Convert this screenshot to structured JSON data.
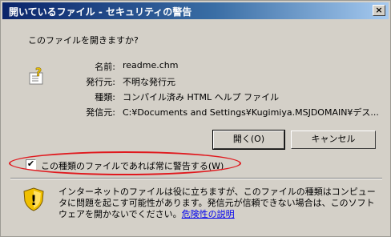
{
  "window": {
    "title": "開いているファイル - セキュリティの警告",
    "close_label": "×"
  },
  "dialog": {
    "prompt": "このファイルを開きますか?",
    "file_icon": "help-file-icon",
    "fields": [
      {
        "label": "名前:",
        "value": "readme.chm"
      },
      {
        "label": "発行元:",
        "value": "不明な発行元"
      },
      {
        "label": "種類:",
        "value": "コンパイル済み HTML ヘルプ ファイル"
      },
      {
        "label": "発信元:",
        "value": "C:¥Documents and Settings¥Kugimiya.MSJDOMAIN¥デス..."
      }
    ],
    "buttons": {
      "open": "開く(O)",
      "cancel": "キャンセル"
    },
    "checkbox": {
      "checked": true,
      "mark": "✔",
      "label": "この種類のファイルであれば常に警告する(W)"
    },
    "warning": {
      "icon": "security-shield-icon",
      "text": "インターネットのファイルは役に立ちますが、このファイルの種類はコンピュータに問題を起こす可能性があります。発信元が信頼できない場合は、このソフトウェアを開かないでください。",
      "link": "危険性の説明"
    }
  },
  "colors": {
    "titlebar_start": "#0a246a",
    "titlebar_end": "#a6caf0",
    "dialog_bg": "#d4d0c8",
    "annotation": "#e0191e"
  }
}
